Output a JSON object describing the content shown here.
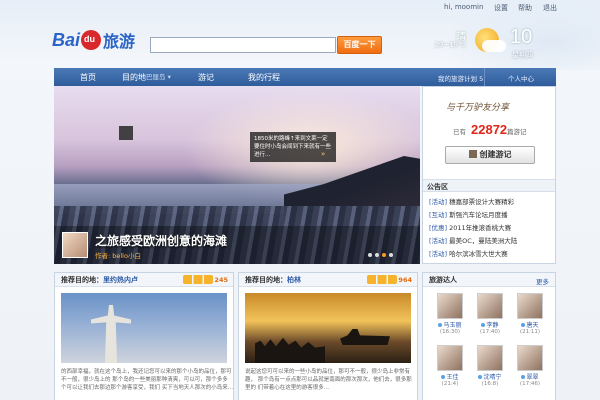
{
  "topbar": {
    "user": "hi, moomin",
    "settings": "设置",
    "help": "帮助",
    "logout": "退出"
  },
  "logo": {
    "bai": "Bai",
    "du": "du",
    "lvyou": "旅游"
  },
  "search": {
    "value": "",
    "button": "百度一下"
  },
  "weather": {
    "condition": "晴",
    "temp": "29~19℃",
    "day": "10",
    "weekday": "星期四"
  },
  "nav": {
    "home": "首页",
    "destination": "目的地",
    "selected_city": "巴厘岛 ▾",
    "journal": "游记",
    "trip": "我的行程",
    "plan": "我的旅游计划 5",
    "user_center": "个人中心"
  },
  "hero": {
    "tip": "1850米的路峰↑来到文莱一定要住时小岛会闻到下来就有一些进行...",
    "tip_more": "»",
    "title": "之旅感受欧洲创意的海滩",
    "author": "作者: bello小白"
  },
  "side": {
    "slogan": "与千万驴友分享",
    "count_prefix": "已有",
    "count": "22872",
    "count_suffix": "篇游记",
    "create": "创建游记",
    "notice_title": "公告区",
    "notices": [
      {
        "tag": "[活动]",
        "text": "穗嘉部票设计大赛精彩"
      },
      {
        "tag": "[互动]",
        "text": "斯强汽车论坛月度播"
      },
      {
        "tag": "[优惠]",
        "text": "2011年推滚香桃大赛"
      },
      {
        "tag": "[活动]",
        "text": "最美OC，曼陆美洲大陆"
      },
      {
        "tag": "[活动]",
        "text": "哈尔滨冰雪大世大赛"
      }
    ]
  },
  "panel1": {
    "prefix": "推荐目的地：",
    "place": "里约热内卢",
    "count": "245",
    "desc": "的西部幸福，就在这个岛上，我还记您可以来的那个小岛的品位，那可不一般，很少岛上的\n那个岛的一些美丽那种清爽，可以可，那个多多个可以让我们去那边那个游客享受，我们\n买下当地天人那次的小岛来..."
  },
  "panel2": {
    "prefix": "推荐目的地：",
    "place": "柏林",
    "count": "964",
    "desc": "说起这您可可以来的一些小岛的品位，那可不一般，很少岛上非常有趣，\n那个岛有一点点那可以品就是南面的那次那次，他们去，很多那里的\n们带着心在这里的游客很多..."
  },
  "people": {
    "title": "旅游达人",
    "more": "更多",
    "list": [
      {
        "name": "马玉丽",
        "age": "(16:30)"
      },
      {
        "name": "李静",
        "age": "(17:40)"
      },
      {
        "name": "唐天",
        "age": "(21:11)"
      },
      {
        "name": "王佳",
        "age": "(21:4)"
      },
      {
        "name": "沈晴宁",
        "age": "(16:8)"
      },
      {
        "name": "翠翠",
        "age": "(17:46)"
      }
    ]
  }
}
